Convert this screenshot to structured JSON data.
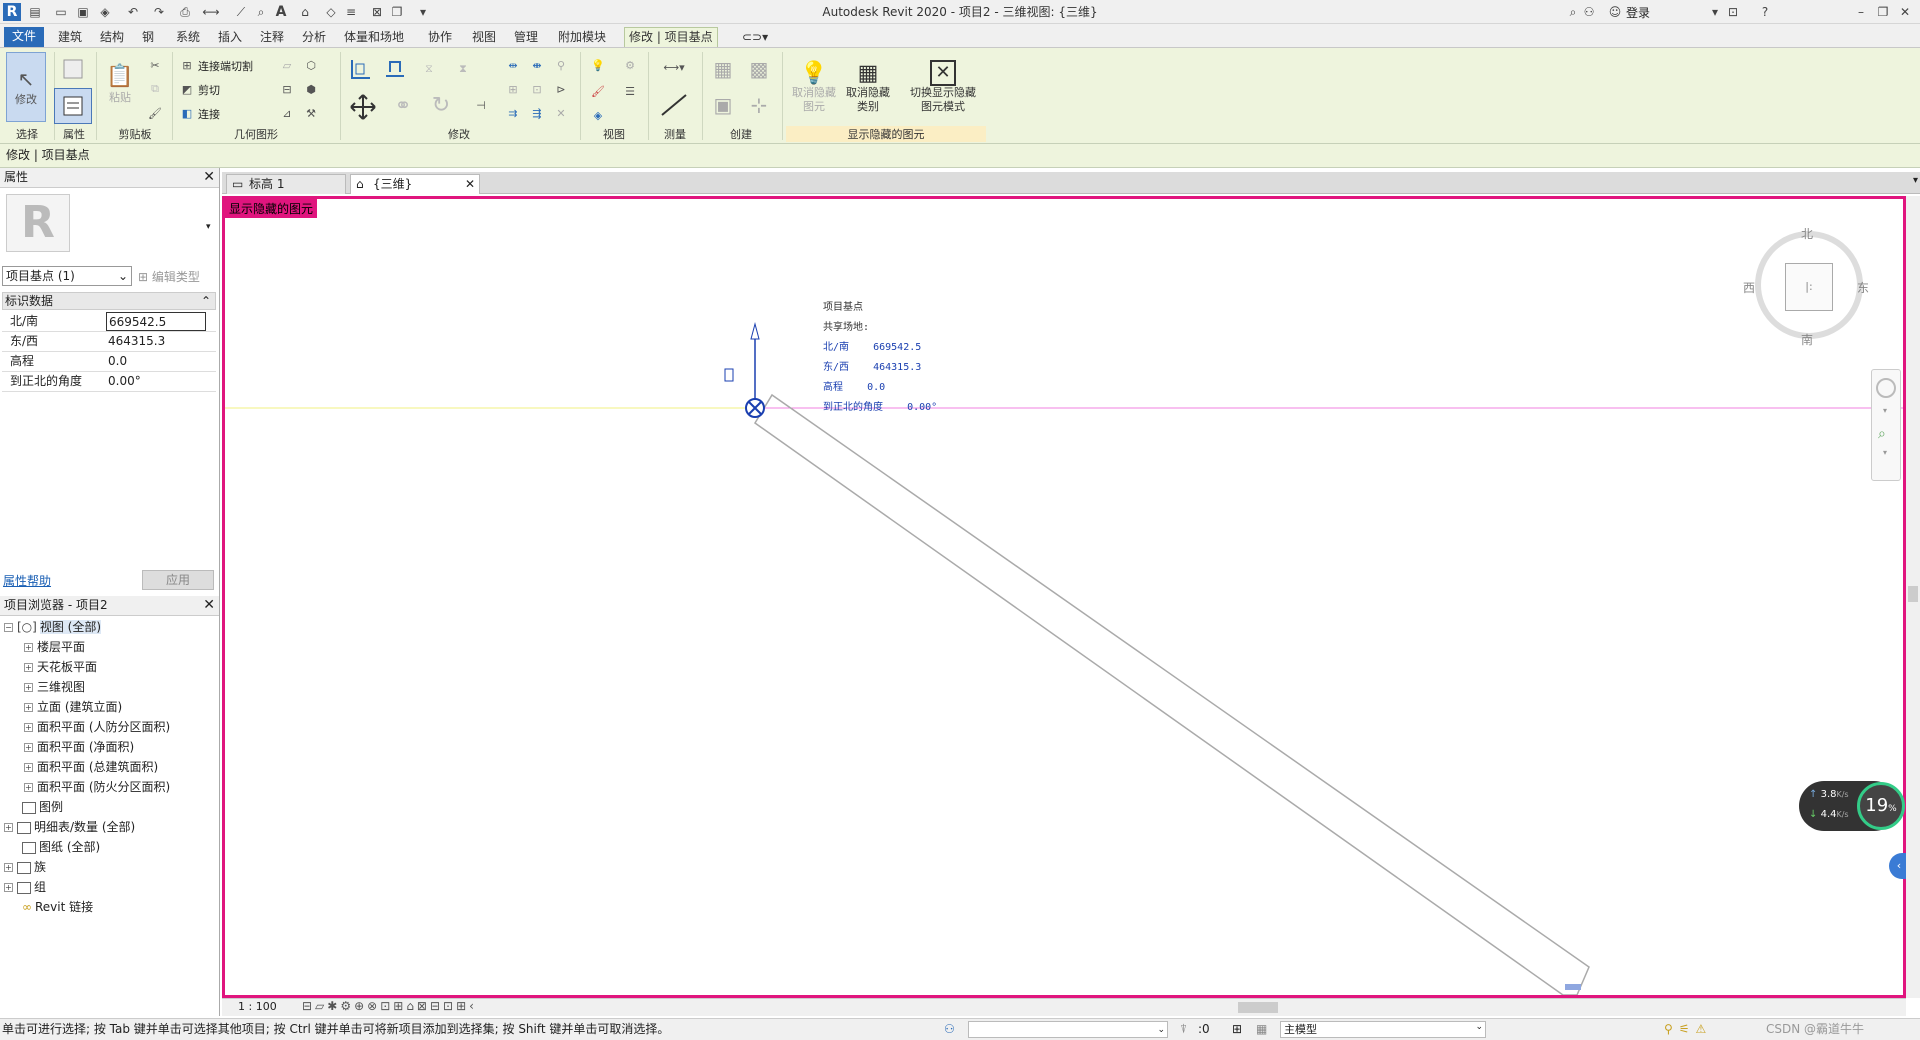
{
  "window": {
    "title": "Autodesk Revit 2020 - 项目2 - 三维视图: {三维}",
    "login_label": "登录"
  },
  "tabs": [
    {
      "label": "文件"
    },
    {
      "label": "建筑"
    },
    {
      "label": "结构"
    },
    {
      "label": "钢"
    },
    {
      "label": "系统"
    },
    {
      "label": "插入"
    },
    {
      "label": "注释"
    },
    {
      "label": "分析"
    },
    {
      "label": "体量和场地"
    },
    {
      "label": "协作"
    },
    {
      "label": "视图"
    },
    {
      "label": "管理"
    },
    {
      "label": "附加模块"
    },
    {
      "label": "修改 | 项目基点"
    }
  ],
  "ribbon": {
    "modify": "修改",
    "properties_panel": "属性",
    "paste": "粘贴",
    "join_cut": "连接端切割",
    "cut": "剪切",
    "join": "连接",
    "unhide_element": "取消隐藏\n图元",
    "unhide_category": "取消隐藏\n类别",
    "toggle_reveal": "切换显示隐藏\n图元模式",
    "panels": {
      "select": "选择",
      "properties": "属性",
      "clipboard": "剪贴板",
      "geometry": "几何图形",
      "modify": "修改",
      "view": "视图",
      "measure": "测量",
      "create": "创建",
      "reveal": "显示隐藏的图元"
    }
  },
  "context_bar": {
    "text": "修改 | 项目基点"
  },
  "properties": {
    "title": "属性",
    "type_selector": "项目基点 (1)",
    "edit_type": "编辑类型",
    "section": "标识数据",
    "rows": [
      {
        "key": "北/南",
        "value": "669542.5"
      },
      {
        "key": "东/西",
        "value": "464315.3"
      },
      {
        "key": "高程",
        "value": "0.0"
      },
      {
        "key": "到正北的角度",
        "value": "0.00°"
      }
    ],
    "help_link": "属性帮助",
    "apply": "应用"
  },
  "browser": {
    "title": "项目浏览器 - 项目2",
    "items": [
      {
        "label": "视图 (全部)",
        "expander": "−"
      },
      {
        "label": "楼层平面",
        "expander": "+"
      },
      {
        "label": "天花板平面",
        "expander": "+"
      },
      {
        "label": "三维视图",
        "expander": "+"
      },
      {
        "label": "立面 (建筑立面)",
        "expander": "+"
      },
      {
        "label": "面积平面 (人防分区面积)",
        "expander": "+"
      },
      {
        "label": "面积平面 (净面积)",
        "expander": "+"
      },
      {
        "label": "面积平面 (总建筑面积)",
        "expander": "+"
      },
      {
        "label": "面积平面 (防火分区面积)",
        "expander": "+"
      },
      {
        "label": "图例",
        "expander": ""
      },
      {
        "label": "明细表/数量 (全部)",
        "expander": "+"
      },
      {
        "label": "图纸 (全部)",
        "expander": ""
      },
      {
        "label": "族",
        "expander": "+"
      },
      {
        "label": "组",
        "expander": "+"
      },
      {
        "label": "Revit 链接",
        "expander": ""
      }
    ]
  },
  "view_tabs": [
    {
      "label": "标高 1"
    },
    {
      "label": "{三维}"
    }
  ],
  "canvas": {
    "hidden_label": "显示隐藏的图元",
    "annotation": {
      "title": "项目基点",
      "shared_site": "共享场地:",
      "ns": "北/南    669542.5",
      "ew": "东/西    464315.3",
      "elev": "高程    0.0",
      "angle": "到正北的角度    0.00°"
    },
    "viewcube": {
      "north": "北",
      "south": "南",
      "east": "东",
      "west": "西"
    }
  },
  "view_control": {
    "scale": "1 : 100"
  },
  "network_widget": {
    "up": "3.8",
    "down": "4.4",
    "unit": "K/s",
    "percent": "19",
    "percent_unit": "%"
  },
  "status": {
    "text": "单击可进行选择; 按 Tab 键并单击可选择其他项目; 按 Ctrl 键并单击可将新项目添加到选择集; 按 Shift 键并单击可取消选择。",
    "model": "主模型",
    "zero": ":0",
    "watermark": "CSDN @霸道牛牛"
  }
}
